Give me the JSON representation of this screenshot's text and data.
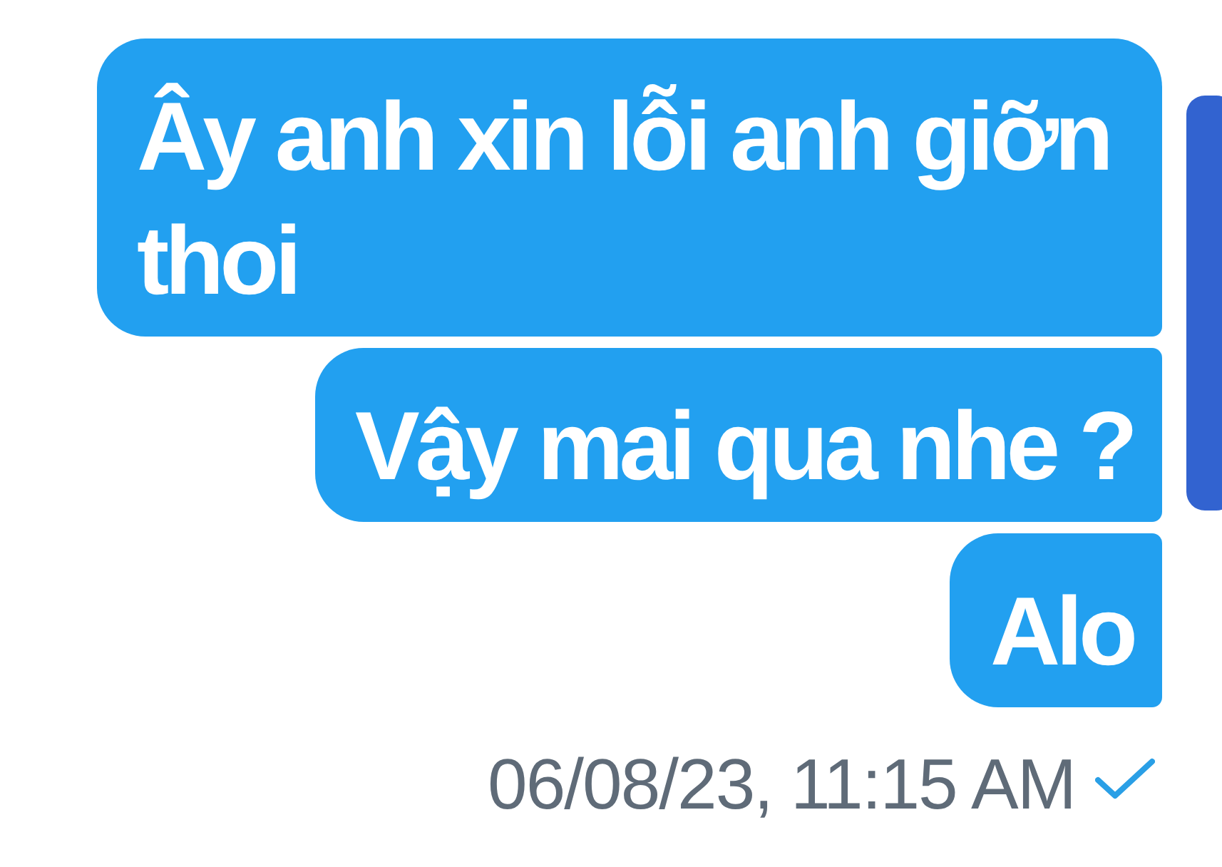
{
  "messages": [
    {
      "text": "Ây anh xin lỗi anh giỡn thoi"
    },
    {
      "text": "Vậy mai qua nhe ?"
    },
    {
      "text": "Alo"
    }
  ],
  "footer": {
    "timestamp": "06/08/23, 11:15 AM",
    "read": false
  }
}
